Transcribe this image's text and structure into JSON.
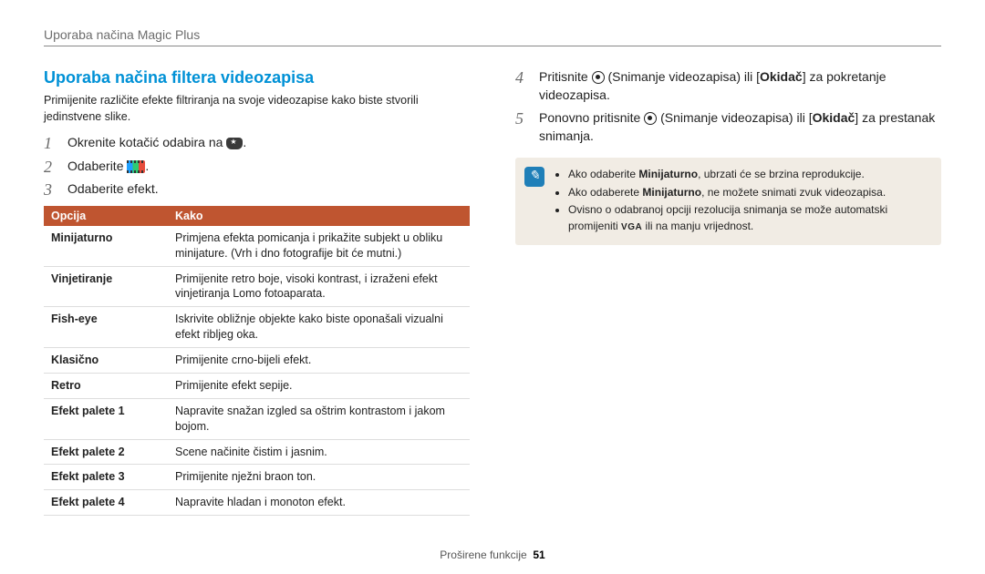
{
  "breadcrumb": "Uporaba načina Magic Plus",
  "heading": "Uporaba načina filtera videozapisa",
  "intro": "Primijenite različite efekte filtriranja na svoje videozapise kako biste stvorili jedinstvene slike.",
  "left_steps": {
    "s1": "Okrenite kotačić odabira na ",
    "s1_tail": ".",
    "s2": "Odaberite ",
    "s2_tail": ".",
    "s3": "Odaberite efekt."
  },
  "table": {
    "head_opt": "Opcija",
    "head_how": "Kako",
    "rows": [
      {
        "name": "Minijaturno",
        "desc": "Primjena efekta pomicanja i prikažite subjekt u obliku minijature. (Vrh i dno fotografije bit će mutni.)"
      },
      {
        "name": "Vinjetiranje",
        "desc": "Primijenite retro boje, visoki kontrast, i izraženi efekt vinjetiranja Lomo fotoaparata."
      },
      {
        "name": "Fish-eye",
        "desc": "Iskrivite obližnje objekte kako biste oponašali vizualni efekt ribljeg oka."
      },
      {
        "name": "Klasično",
        "desc": "Primijenite crno-bijeli efekt."
      },
      {
        "name": "Retro",
        "desc": "Primijenite efekt sepije."
      },
      {
        "name": "Efekt palete 1",
        "desc": "Napravite snažan izgled sa oštrim kontrastom i jakom bojom."
      },
      {
        "name": "Efekt palete 2",
        "desc": "Scene načinite čistim i jasnim."
      },
      {
        "name": "Efekt palete 3",
        "desc": "Primijenite nježni braon ton."
      },
      {
        "name": "Efekt palete 4",
        "desc": "Napravite hladan i monoton efekt."
      }
    ]
  },
  "right_steps": {
    "s4_a": "Pritisnite ",
    "s4_b": " (Snimanje videozapisa) ili [",
    "s4_bold": "Okidač",
    "s4_c": "] za pokretanje videozapisa.",
    "s5_a": "Ponovno pritisnite ",
    "s5_b": " (Snimanje videozapisa) ili [",
    "s5_bold": "Okidač",
    "s5_c": "] za prestanak snimanja."
  },
  "note": {
    "b1_a": "Ako odaberite ",
    "b1_bold": "Minijaturno",
    "b1_b": ", ubrzati će se brzina reprodukcije.",
    "b2_a": "Ako odaberete ",
    "b2_bold": "Minijaturno",
    "b2_b": ", ne možete snimati zvuk videozapisa.",
    "b3_a": "Ovisno o odabranoj opciji rezolucija snimanja se može automatski promijeniti ",
    "b3_vga": "VGA",
    "b3_b": " ili na manju vrijednost."
  },
  "footer": {
    "section": "Proširene funkcije",
    "page": "51"
  }
}
